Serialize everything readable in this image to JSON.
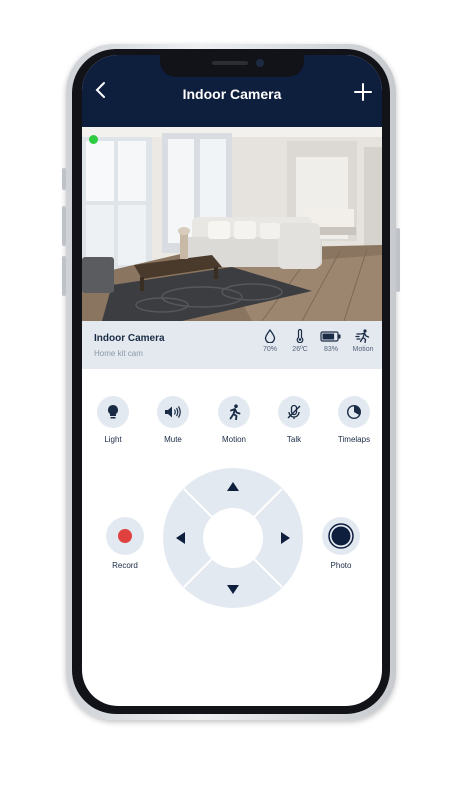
{
  "header": {
    "title": "Indoor Camera",
    "back_icon": "chevron-left-icon",
    "add_icon": "plus-icon"
  },
  "camera": {
    "name": "Indoor Camera",
    "subtitle": "Home kit cam",
    "live_color": "#2ecc40"
  },
  "stats": [
    {
      "icon": "humidity-drop-icon",
      "value": "70%"
    },
    {
      "icon": "thermometer-icon",
      "value": "26ºC"
    },
    {
      "icon": "battery-icon",
      "value": "83%",
      "level": 0.83
    },
    {
      "icon": "motion-runner-icon",
      "value": "Motion"
    }
  ],
  "controls": [
    {
      "icon": "lightbulb-icon",
      "label": "Light"
    },
    {
      "icon": "speaker-icon",
      "label": "Mute"
    },
    {
      "icon": "runner-icon",
      "label": "Motion"
    },
    {
      "icon": "mic-off-icon",
      "label": "Talk"
    },
    {
      "icon": "timelapse-icon",
      "label": "Timelaps"
    }
  ],
  "actions": {
    "record_label": "Record",
    "photo_label": "Photo"
  },
  "colors": {
    "header_bg": "#0e1e3d",
    "accent_red": "#e0413f",
    "control_bg": "#e3e9f0",
    "text_dark": "#1a2b45"
  }
}
